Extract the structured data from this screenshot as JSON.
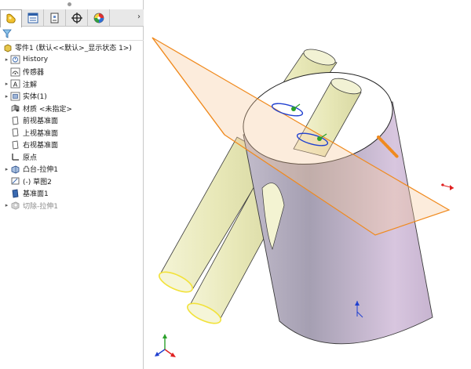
{
  "panel": {
    "tabs": [
      {
        "name": "feature-manager",
        "icon": "feature-manager-icon"
      },
      {
        "name": "property-manager",
        "icon": "property-manager-icon"
      },
      {
        "name": "configuration-manager",
        "icon": "configuration-manager-icon"
      },
      {
        "name": "dimxpert-manager",
        "icon": "crosshair-icon"
      },
      {
        "name": "display-manager",
        "icon": "appearance-wheel-icon"
      }
    ],
    "tab_arrow": "›",
    "filter_icon": "filter-icon"
  },
  "tree": {
    "root": "零件1 (默认<<默认>_显示状态 1>)",
    "items": [
      {
        "label": "History",
        "icon": "history-folder-icon",
        "expander": "▸"
      },
      {
        "label": "传感器",
        "icon": "sensor-folder-icon",
        "expander": ""
      },
      {
        "label": "注解",
        "icon": "annotations-icon",
        "expander": "▸"
      },
      {
        "label": "实体(1)",
        "icon": "solid-bodies-icon",
        "expander": "▸"
      },
      {
        "label": "材质 <未指定>",
        "icon": "material-icon",
        "expander": ""
      },
      {
        "label": "前视基准面",
        "icon": "plane-icon",
        "expander": ""
      },
      {
        "label": "上视基准面",
        "icon": "plane-icon",
        "expander": ""
      },
      {
        "label": "右视基准面",
        "icon": "plane-icon",
        "expander": ""
      },
      {
        "label": "原点",
        "icon": "origin-icon",
        "expander": ""
      },
      {
        "label": "凸台-拉伸1",
        "icon": "boss-extrude-icon",
        "expander": "▸"
      },
      {
        "label": "(-) 草图2",
        "icon": "sketch-icon",
        "expander": ""
      },
      {
        "label": "基准面1",
        "icon": "plane-icon",
        "expander": ""
      },
      {
        "label": "切除-拉伸1",
        "icon": "cut-extrude-icon",
        "expander": "▸",
        "suppressed": true
      }
    ]
  },
  "colors": {
    "plane_edge": "#f08a1e",
    "plane_fill": "#f7c99a",
    "cylinder_body": "#c9bfd0",
    "rod_fill": "#eeeec2",
    "rod_edge": "#f2e23a",
    "axis_x": "#e02020",
    "axis_y": "#2aa02a",
    "axis_z": "#2040d0"
  }
}
